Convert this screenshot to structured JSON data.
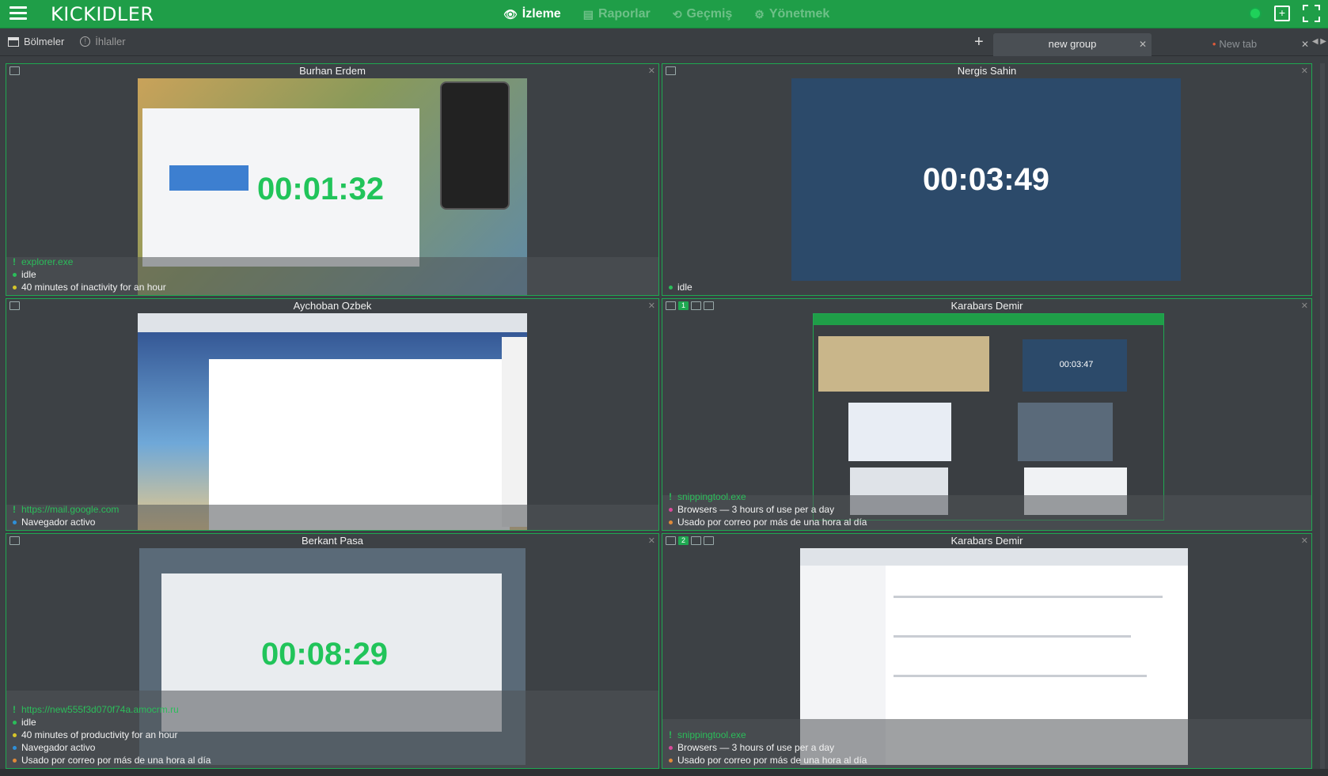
{
  "app": {
    "logo": "KICKIDLER"
  },
  "nav": [
    {
      "label": "İzleme",
      "icon": "eye-icon",
      "active": true
    },
    {
      "label": "Raporlar",
      "icon": "report-icon",
      "active": false
    },
    {
      "label": "Geçmiş",
      "icon": "history-icon",
      "active": false
    },
    {
      "label": "Yönetmek",
      "icon": "gear-icon",
      "active": false
    }
  ],
  "subbar": {
    "sections": "Bölmeler",
    "violations": "İhlaller"
  },
  "tabs": [
    {
      "label": "new group",
      "active": true
    },
    {
      "label": "New tab",
      "active": false
    }
  ],
  "panes": [
    {
      "name": "Burhan Erdem",
      "timer": "00:01:32",
      "info": [
        {
          "text": "explorer.exe",
          "type": "app"
        },
        {
          "text": "idle",
          "color": "#2bbd5a"
        },
        {
          "text": "40 minutes of inactivity for an hour",
          "color": "#d6c52a"
        }
      ]
    },
    {
      "name": "Nergis Sahin",
      "timer": "00:03:49",
      "info": [
        {
          "text": "idle",
          "color": "#2bbd5a"
        }
      ]
    },
    {
      "name": "Aychoban Ozbek",
      "timer": "",
      "info": [
        {
          "text": "https://mail.google.com",
          "type": "app"
        },
        {
          "text": "Navegador activo",
          "color": "#2e8fd8"
        }
      ]
    },
    {
      "name": "Karabars Demir",
      "timer": "00:03:47",
      "info": [
        {
          "text": "snippingtool.exe",
          "type": "app"
        },
        {
          "text": "Browsers — 3 hours of use per a day",
          "color": "#d94a9a"
        },
        {
          "text": "Usado por correo por más de una hora al día",
          "color": "#e08a3a"
        }
      ]
    },
    {
      "name": "Berkant Pasa",
      "timer": "00:08:29",
      "info": [
        {
          "text": "https://new555f3d070f74a.amocrm.ru",
          "type": "app"
        },
        {
          "text": "idle",
          "color": "#2bbd5a"
        },
        {
          "text": "40 minutes of productivity for an hour",
          "color": "#d6c52a"
        },
        {
          "text": "Navegador activo",
          "color": "#2e8fd8"
        },
        {
          "text": "Usado por correo por más de una hora al día",
          "color": "#e08a3a"
        }
      ]
    },
    {
      "name": "Karabars Demir",
      "timer": "",
      "info": [
        {
          "text": "snippingtool.exe",
          "type": "app"
        },
        {
          "text": "Browsers — 3 hours of use per a day",
          "color": "#d94a9a"
        },
        {
          "text": "Usado por correo por más de una hora al día",
          "color": "#e08a3a"
        }
      ]
    }
  ]
}
